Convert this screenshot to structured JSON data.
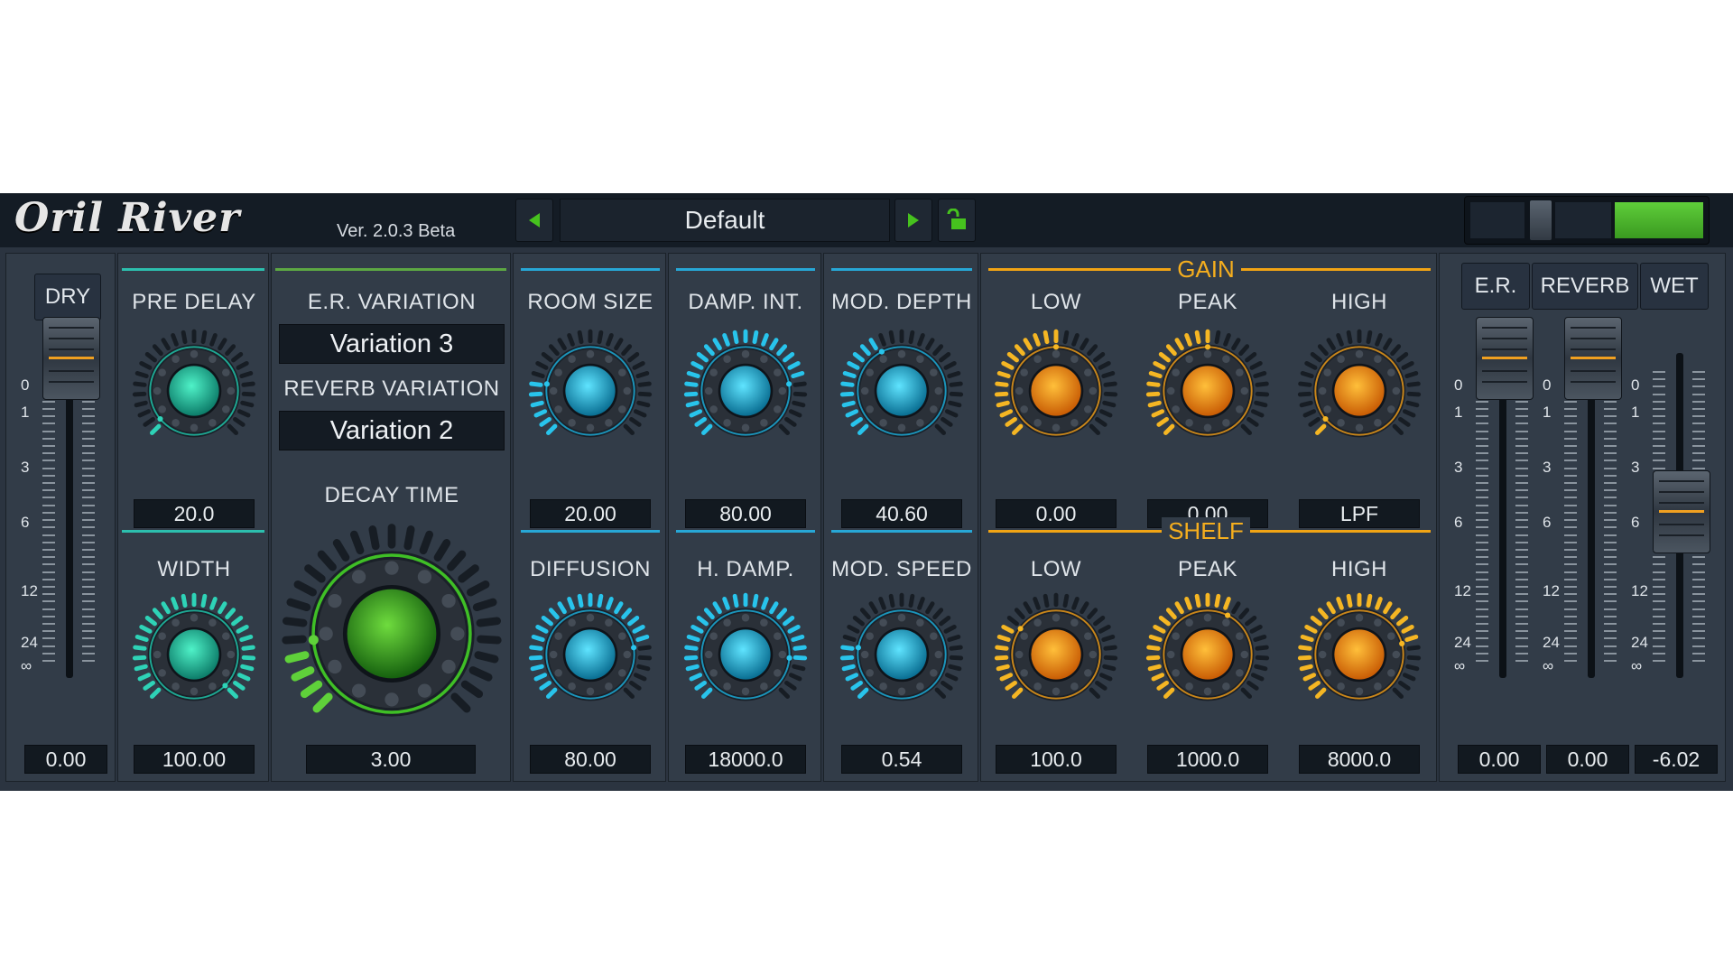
{
  "header": {
    "logo": "Oril River",
    "version": "Ver. 2.0.3 Beta",
    "preset": "Default",
    "prev_icon": "triangle-left-icon",
    "next_icon": "triangle-right-icon",
    "lock_icon": "unlock-icon"
  },
  "colors": {
    "background": "#2b3440",
    "panel": "#323c48",
    "green_accent": "#5da843",
    "teal_accent": "#2cbfae",
    "blue_accent": "#27a7d6",
    "gold_accent": "#f1a414"
  },
  "dry": {
    "label": "DRY",
    "value": "0.00"
  },
  "pre_delay": {
    "label": "PRE DELAY",
    "value": "20.0"
  },
  "width": {
    "label": "WIDTH",
    "value": "100.00"
  },
  "er_variation": {
    "label": "E.R. VARIATION",
    "value": "Variation 3"
  },
  "reverb_variation": {
    "label": "REVERB VARIATION",
    "value": "Variation 2"
  },
  "decay_time": {
    "label": "DECAY TIME",
    "value": "3.00"
  },
  "room_size": {
    "label": "ROOM SIZE",
    "value": "20.00"
  },
  "diffusion": {
    "label": "DIFFUSION",
    "value": "80.00"
  },
  "damp_int": {
    "label": "DAMP. INT.",
    "value": "80.00"
  },
  "h_damp": {
    "label": "H. DAMP.",
    "value": "18000.0"
  },
  "mod_depth": {
    "label": "MOD. DEPTH",
    "value": "40.60"
  },
  "mod_speed": {
    "label": "MOD. SPEED",
    "value": "0.54"
  },
  "gain": {
    "label": "GAIN",
    "low": {
      "label": "LOW",
      "value": "0.00"
    },
    "peak": {
      "label": "PEAK",
      "value": "0.00"
    },
    "high": {
      "label": "HIGH",
      "value": "LPF"
    }
  },
  "shelf": {
    "label": "SHELF",
    "low": {
      "label": "LOW",
      "value": "100.0"
    },
    "peak": {
      "label": "PEAK",
      "value": "1000.0"
    },
    "high": {
      "label": "HIGH",
      "value": "8000.0"
    }
  },
  "output": {
    "er": {
      "label": "E.R.",
      "value": "0.00"
    },
    "reverb": {
      "label": "REVERB",
      "value": "0.00"
    },
    "wet": {
      "label": "WET",
      "value": "-6.02"
    }
  },
  "scale_labels": [
    "0",
    "1",
    "3",
    "6",
    "12",
    "24",
    "∞"
  ]
}
